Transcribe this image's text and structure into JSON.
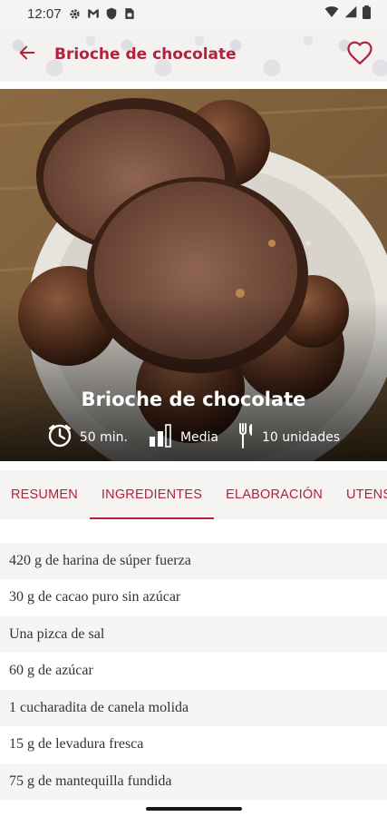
{
  "status_bar": {
    "time": "12:07",
    "icons": [
      "gear-icon",
      "gmail-icon",
      "shield-icon",
      "sim-icon",
      "wifi-icon",
      "signal-icon",
      "battery-icon"
    ]
  },
  "app_bar": {
    "title": "Brioche de chocolate",
    "back_icon": "arrow-left-icon",
    "favorite_icon": "heart-outline-icon"
  },
  "hero": {
    "title": "Brioche de chocolate",
    "time": "50 min.",
    "difficulty": "Media",
    "servings": "10 unidades"
  },
  "tabs": [
    {
      "label": "RESUMEN",
      "active": false
    },
    {
      "label": "INGREDIENTES",
      "active": true
    },
    {
      "label": "ELABORACIÓN",
      "active": false
    },
    {
      "label": "UTENSILIOS",
      "active": false
    }
  ],
  "ingredients": [
    "420 g de harina de súper fuerza",
    "30 g de cacao puro sin azúcar",
    "Una pizca de sal",
    "60 g de azúcar",
    "1 cucharadita de canela molida",
    "15 g de levadura fresca",
    "75 g de mantequilla fundida"
  ],
  "colors": {
    "accent": "#b1223d",
    "row_alt": "#f5f5f5"
  }
}
